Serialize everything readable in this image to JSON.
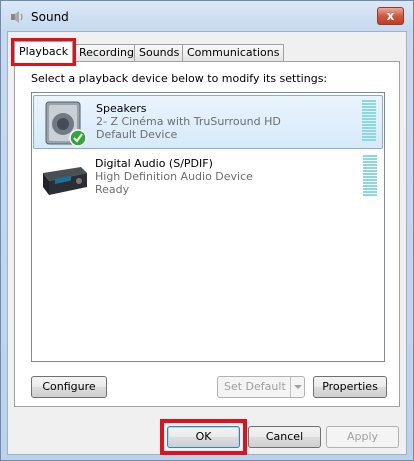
{
  "window": {
    "title": "Sound",
    "close_label": "x"
  },
  "tabs": [
    {
      "label": "Playback"
    },
    {
      "label": "Recording"
    },
    {
      "label": "Sounds"
    },
    {
      "label": "Communications"
    }
  ],
  "instruction": "Select a playback device below to modify its settings:",
  "devices": [
    {
      "name": "Speakers",
      "description": "2- Z Cinéma with TruSurround HD",
      "status": "Default Device",
      "icon": "speaker-icon"
    },
    {
      "name": "Digital Audio (S/PDIF)",
      "description": "High Definition Audio Device",
      "status": "Ready",
      "icon": "digital-audio-receiver-icon"
    }
  ],
  "buttons": {
    "configure": "Configure",
    "set_default": "Set Default",
    "properties": "Properties",
    "ok": "OK",
    "cancel": "Cancel",
    "apply": "Apply"
  },
  "colors": {
    "highlight": "#e0101e",
    "selection": "#d6eafa",
    "meter": "#8dd8e0"
  }
}
